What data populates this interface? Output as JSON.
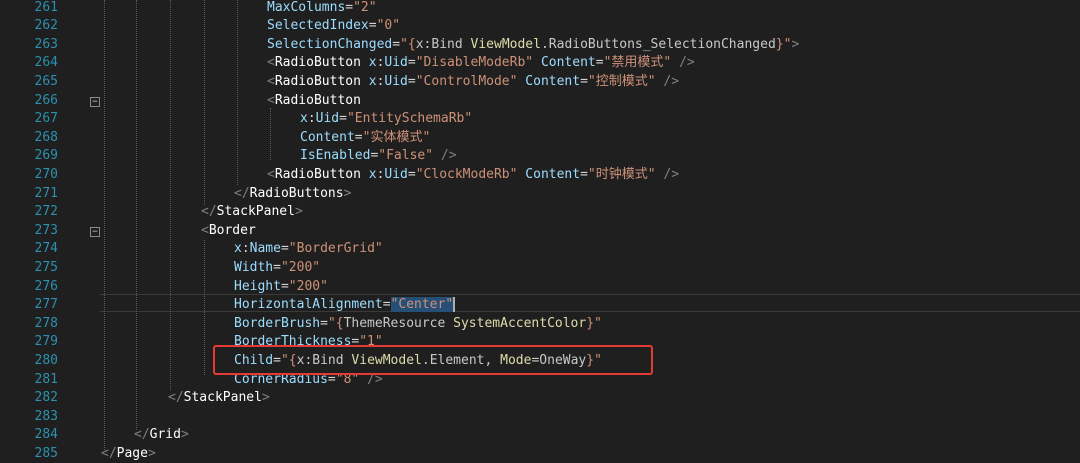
{
  "line_numbers": [
    "261",
    "262",
    "263",
    "264",
    "265",
    "266",
    "267",
    "268",
    "269",
    "270",
    "271",
    "272",
    "273",
    "274",
    "275",
    "276",
    "277",
    "278",
    "279",
    "280",
    "281",
    "282",
    "283",
    "284",
    "285"
  ],
  "lines": [
    {
      "id": "l261",
      "tokens": [
        [
          "a",
          "MaxColumns"
        ],
        [
          "p",
          "="
        ],
        [
          "s",
          "\"2\""
        ]
      ]
    },
    {
      "id": "l262",
      "tokens": [
        [
          "a",
          "SelectedIndex"
        ],
        [
          "p",
          "="
        ],
        [
          "s",
          "\"0\""
        ]
      ]
    },
    {
      "id": "l263",
      "tokens": [
        [
          "a",
          "SelectionChanged"
        ],
        [
          "p",
          "="
        ],
        [
          "s",
          "\"{"
        ],
        [
          "e",
          "x:Bind "
        ],
        [
          "y",
          "ViewModel"
        ],
        [
          "e",
          "."
        ],
        [
          "e",
          "RadioButtons_SelectionChanged"
        ],
        [
          "s",
          "}\""
        ],
        [
          "b",
          ">"
        ]
      ]
    },
    {
      "id": "l264",
      "tokens": [
        [
          "b",
          "<"
        ],
        [
          "t",
          "RadioButton "
        ],
        [
          "a",
          "x"
        ],
        [
          "p",
          ":"
        ],
        [
          "a",
          "Uid"
        ],
        [
          "p",
          "="
        ],
        [
          "s",
          "\"DisableModeRb\" "
        ],
        [
          "a",
          "Content"
        ],
        [
          "p",
          "="
        ],
        [
          "s",
          "\"禁用模式\" "
        ],
        [
          "b",
          "/>"
        ]
      ]
    },
    {
      "id": "l265",
      "tokens": [
        [
          "b",
          "<"
        ],
        [
          "t",
          "RadioButton "
        ],
        [
          "a",
          "x"
        ],
        [
          "p",
          ":"
        ],
        [
          "a",
          "Uid"
        ],
        [
          "p",
          "="
        ],
        [
          "s",
          "\"ControlMode\" "
        ],
        [
          "a",
          "Content"
        ],
        [
          "p",
          "="
        ],
        [
          "s",
          "\"控制模式\" "
        ],
        [
          "b",
          "/>"
        ]
      ]
    },
    {
      "id": "l266",
      "tokens": [
        [
          "b",
          "<"
        ],
        [
          "t",
          "RadioButton"
        ]
      ]
    },
    {
      "id": "l267",
      "tokens": [
        [
          "a",
          "x"
        ],
        [
          "p",
          ":"
        ],
        [
          "a",
          "Uid"
        ],
        [
          "p",
          "="
        ],
        [
          "s",
          "\"EntitySchemaRb\""
        ]
      ]
    },
    {
      "id": "l268",
      "tokens": [
        [
          "a",
          "Content"
        ],
        [
          "p",
          "="
        ],
        [
          "s",
          "\"实体模式\""
        ]
      ]
    },
    {
      "id": "l269",
      "tokens": [
        [
          "a",
          "IsEnabled"
        ],
        [
          "p",
          "="
        ],
        [
          "s",
          "\"False\" "
        ],
        [
          "b",
          "/>"
        ]
      ]
    },
    {
      "id": "l270",
      "tokens": [
        [
          "b",
          "<"
        ],
        [
          "t",
          "RadioButton "
        ],
        [
          "a",
          "x"
        ],
        [
          "p",
          ":"
        ],
        [
          "a",
          "Uid"
        ],
        [
          "p",
          "="
        ],
        [
          "s",
          "\"ClockModeRb\" "
        ],
        [
          "a",
          "Content"
        ],
        [
          "p",
          "="
        ],
        [
          "s",
          "\"时钟模式\" "
        ],
        [
          "b",
          "/>"
        ]
      ]
    },
    {
      "id": "l271",
      "tokens": [
        [
          "b",
          "</"
        ],
        [
          "t",
          "RadioButtons"
        ],
        [
          "b",
          ">"
        ]
      ]
    },
    {
      "id": "l272",
      "tokens": [
        [
          "b",
          "</"
        ],
        [
          "t",
          "StackPanel"
        ],
        [
          "b",
          ">"
        ]
      ]
    },
    {
      "id": "l273",
      "tokens": [
        [
          "b",
          "<"
        ],
        [
          "t",
          "Border"
        ]
      ]
    },
    {
      "id": "l274",
      "tokens": [
        [
          "a",
          "x"
        ],
        [
          "p",
          ":"
        ],
        [
          "a",
          "Name"
        ],
        [
          "p",
          "="
        ],
        [
          "s",
          "\"BorderGrid\""
        ]
      ]
    },
    {
      "id": "l275",
      "tokens": [
        [
          "a",
          "Width"
        ],
        [
          "p",
          "="
        ],
        [
          "s",
          "\"200\""
        ]
      ]
    },
    {
      "id": "l276",
      "tokens": [
        [
          "a",
          "Height"
        ],
        [
          "p",
          "="
        ],
        [
          "s",
          "\"200\""
        ]
      ]
    },
    {
      "id": "l277",
      "tokens": [
        [
          "a",
          "HorizontalAlignment"
        ],
        [
          "p",
          "="
        ],
        [
          "sel",
          "\"Center\""
        ],
        [
          "cur",
          ""
        ]
      ]
    },
    {
      "id": "l278",
      "tokens": [
        [
          "a",
          "BorderBrush"
        ],
        [
          "p",
          "="
        ],
        [
          "s",
          "\"{"
        ],
        [
          "e",
          "ThemeResource "
        ],
        [
          "y",
          "SystemAccentColor"
        ],
        [
          "s",
          "}\""
        ]
      ]
    },
    {
      "id": "l279",
      "tokens": [
        [
          "a",
          "BorderThickness"
        ],
        [
          "p",
          "="
        ],
        [
          "s",
          "\"1\""
        ]
      ]
    },
    {
      "id": "l280",
      "tokens": [
        [
          "a",
          "Child"
        ],
        [
          "p",
          "="
        ],
        [
          "s",
          "\"{"
        ],
        [
          "e",
          "x:Bind "
        ],
        [
          "y",
          "ViewModel"
        ],
        [
          "e",
          ".Element, "
        ],
        [
          "y",
          "Mode"
        ],
        [
          "e",
          "=OneWay"
        ],
        [
          "s",
          "}\""
        ]
      ]
    },
    {
      "id": "l281",
      "tokens": [
        [
          "a",
          "CornerRadius"
        ],
        [
          "p",
          "="
        ],
        [
          "s",
          "\"8\" "
        ],
        [
          "b",
          "/>"
        ]
      ]
    },
    {
      "id": "l282",
      "tokens": [
        [
          "b",
          "</"
        ],
        [
          "t",
          "StackPanel"
        ],
        [
          "b",
          ">"
        ]
      ]
    },
    {
      "id": "l283",
      "tokens": []
    },
    {
      "id": "l284",
      "tokens": [
        [
          "b",
          "</"
        ],
        [
          "t",
          "Grid"
        ],
        [
          "b",
          ">"
        ]
      ]
    },
    {
      "id": "l285",
      "tokens": [
        [
          "b",
          "</"
        ],
        [
          "t",
          "Page"
        ],
        [
          "b",
          ">"
        ]
      ]
    }
  ],
  "colors": {
    "background": "#1f1f1f",
    "line_number": "#2b91af",
    "attribute": "#9cdcfe",
    "string": "#ce9178",
    "tag": "#ffffff",
    "highlight_box": "#e53935",
    "selection": "#264f78"
  },
  "icons": {
    "fold_marker": "collapse-minus-icon"
  }
}
